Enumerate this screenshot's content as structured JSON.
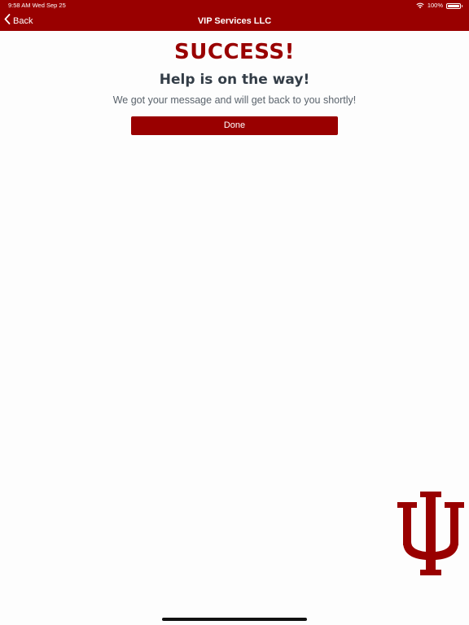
{
  "status_bar": {
    "time_date": "9:58 AM   Wed Sep 25",
    "battery": "100%",
    "battery_level": 1.0
  },
  "nav": {
    "back_label": "Back",
    "title": "VIP Services LLC"
  },
  "content": {
    "heading": "SUCCESS!",
    "subtitle": "Help is on the way!",
    "message": "We got your message and will get back to you shortly!",
    "done_label": "Done"
  },
  "colors": {
    "brand": "#990000",
    "text_dark": "#333d47",
    "text_muted": "#5a636c",
    "background": "#fdfdfd"
  },
  "icons": {
    "back": "chevron-left-icon",
    "wifi": "wifi-icon",
    "battery": "battery-icon",
    "logo": "trident-logo-icon"
  }
}
